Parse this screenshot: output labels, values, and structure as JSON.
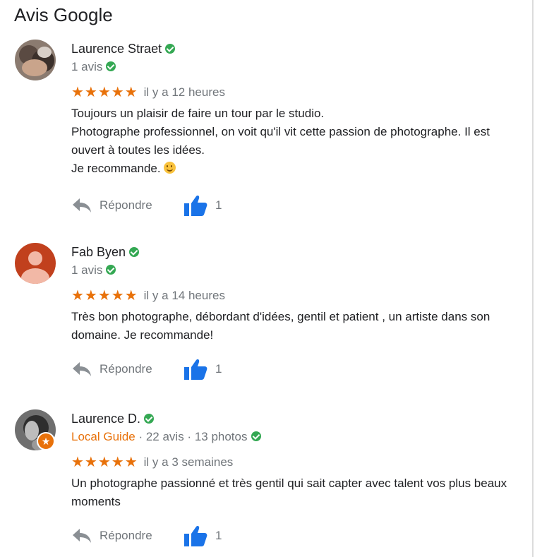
{
  "heading": "Avis Google",
  "colors": {
    "accent_orange": "#e8710a",
    "like_blue": "#1a73e8",
    "verified_green": "#34a853",
    "muted_text": "#70757a"
  },
  "reviews": [
    {
      "author": "Laurence Straet",
      "meta": "1 avis",
      "avatar_icon": "profile-photo",
      "rating": 5,
      "stars": "★★★★★",
      "time": "il y a 12 heures",
      "text_lines": [
        "Toujours un plaisir de faire un tour par le studio.",
        "Photographe professionnel, on voit qu'il vit cette passion de photographe. Il est ouvert à toutes les idées.",
        "Je recommande."
      ],
      "reply_label": "Répondre",
      "likes": "1"
    },
    {
      "author": "Fab Byen",
      "meta": "1 avis",
      "avatar_icon": "default-person-icon",
      "rating": 5,
      "stars": "★★★★★",
      "time": "il y a 14 heures",
      "text_lines": [
        "Très bon photographe, débordant d'idées, gentil et patient , un artiste dans son domaine. Je recommande!"
      ],
      "reply_label": "Répondre",
      "likes": "1"
    },
    {
      "author": "Laurence D.",
      "local_guide": "Local Guide",
      "meta": " · 22 avis · 13 photos",
      "avatar_icon": "profile-photo",
      "rating": 5,
      "stars": "★★★★★",
      "time": "il y a 3 semaines",
      "text_lines": [
        "Un photographe passionné et très gentil qui sait capter avec talent vos plus beaux moments"
      ],
      "reply_label": "Répondre",
      "likes": "1"
    }
  ]
}
